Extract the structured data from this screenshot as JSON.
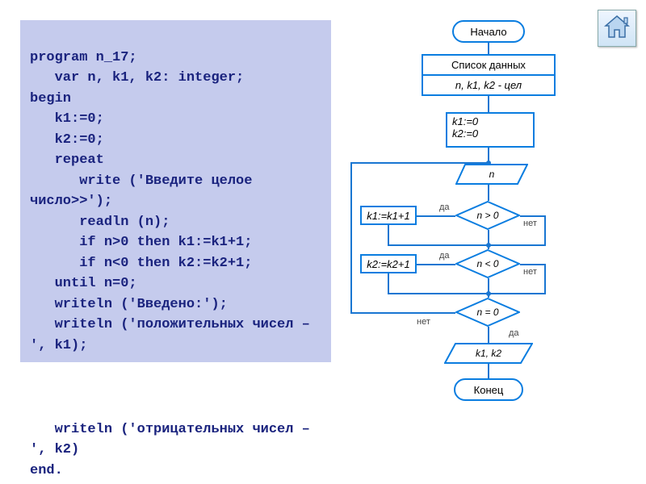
{
  "code": {
    "line01": "program n_17;",
    "line02": "   var n, k1, k2: integer;",
    "line03": "begin",
    "line04": "   k1:=0;",
    "line05": "   k2:=0;",
    "line06": "   repeat",
    "line07": "      write ('Введите целое число>>');",
    "line08": "      readln (n);",
    "line09": "      if n>0 then k1:=k1+1;",
    "line10": "      if n<0 then k2:=k2+1;",
    "line11": "   until n=0;",
    "line12": "   writeln ('Введено:');",
    "line13": "   writeln ('положительных чисел – ', k1);",
    "line14": "   writeln ('отрицательных чисел – ', k2)",
    "line15": "end."
  },
  "flowchart": {
    "start": "Начало",
    "end": "Конец",
    "data_title": "Список данных",
    "data_vars": "n, k1, k2 - цел",
    "init_l1": "k1:=0",
    "init_l2": "k2:=0",
    "input_n": "n",
    "cond1": "n > 0",
    "cond2": "n < 0",
    "cond3": "n = 0",
    "action1": "k1:=k1+1",
    "action2": "k2:=k2+1",
    "output": "k1, k2",
    "yes": "да",
    "no": "нет"
  },
  "icons": {
    "home": "home-icon"
  }
}
